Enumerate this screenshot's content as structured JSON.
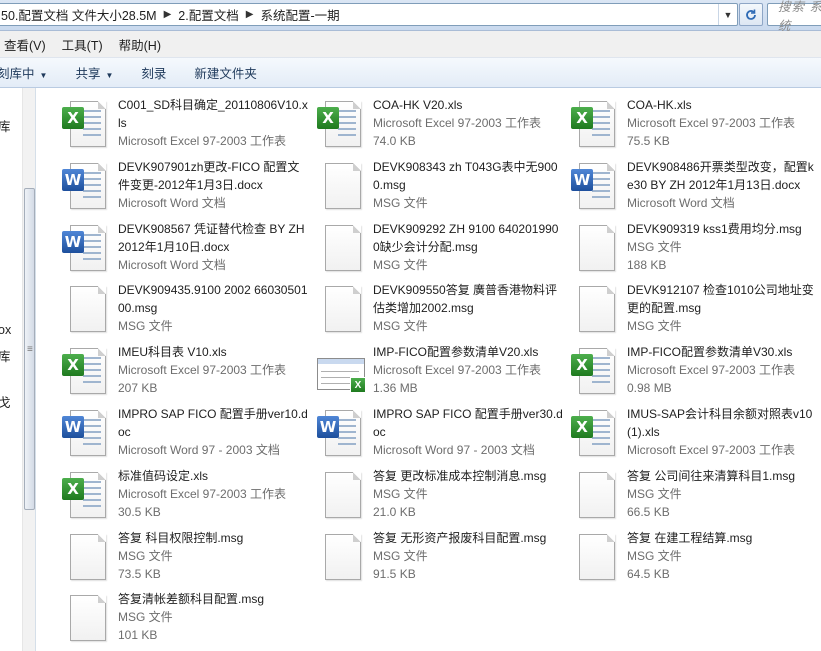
{
  "address": {
    "crumbs": [
      "50.配置文档 文件大小28.5M",
      "2.配置文档",
      "系统配置-一期"
    ],
    "search_placeholder": "搜索 系统"
  },
  "menu": [
    "查看(V)",
    "工具(T)",
    "帮助(H)"
  ],
  "commands": [
    "刻库中",
    "共享",
    "刻录",
    "新建文件夹"
  ],
  "nav": {
    "labels": [
      "库",
      "ox",
      "库",
      "戈"
    ]
  },
  "files": [
    {
      "name": "C001_SD科目确定_20110806V10.xls",
      "type": "Microsoft Excel 97-2003 工作表",
      "size": "",
      "icon": "excel"
    },
    {
      "name": "COA-HK V20.xls",
      "type": "Microsoft Excel 97-2003 工作表",
      "size": "74.0 KB",
      "icon": "excel"
    },
    {
      "name": "COA-HK.xls",
      "type": "Microsoft Excel 97-2003 工作表",
      "size": "75.5 KB",
      "icon": "excel"
    },
    {
      "name": "DEVK907901zh更改-FICO 配置文件变更-2012年1月3日.docx",
      "type": "Microsoft Word 文档",
      "size": "",
      "icon": "word"
    },
    {
      "name": "DEVK908343 zh T043G表中无9000.msg",
      "type": "MSG 文件",
      "size": "",
      "icon": "blank"
    },
    {
      "name": "DEVK908486开票类型改变，配置ke30 BY ZH 2012年1月13日.docx",
      "type": "Microsoft Word 文档",
      "size": "",
      "icon": "word"
    },
    {
      "name": "DEVK908567 凭证替代检查 BY ZH 2012年1月10日.docx",
      "type": "Microsoft Word 文档",
      "size": "",
      "icon": "word"
    },
    {
      "name": "DEVK909292  ZH 9100 6402019900缺少会计分配.msg",
      "type": "MSG 文件",
      "size": "",
      "icon": "blank"
    },
    {
      "name": "DEVK909319 kss1费用均分.msg",
      "type": "MSG 文件",
      "size": "188 KB",
      "icon": "blank"
    },
    {
      "name": "DEVK909435.9100  2002 6603050100.msg",
      "type": "MSG 文件",
      "size": "",
      "icon": "blank"
    },
    {
      "name": "DEVK909550答复 廣普香港物料评估类增加2002.msg",
      "type": "MSG 文件",
      "size": "",
      "icon": "blank"
    },
    {
      "name": "DEVK912107 检查1010公司地址变更的配置.msg",
      "type": "MSG 文件",
      "size": "",
      "icon": "blank"
    },
    {
      "name": "IMEU科目表 V10.xls",
      "type": "Microsoft Excel 97-2003 工作表",
      "size": "207 KB",
      "icon": "excel"
    },
    {
      "name": "IMP-FICO配置参数清单V20.xls",
      "type": "Microsoft Excel 97-2003 工作表",
      "size": "1.36 MB",
      "icon": "excel-preview"
    },
    {
      "name": "IMP-FICO配置参数清单V30.xls",
      "type": "Microsoft Excel 97-2003 工作表",
      "size": "0.98 MB",
      "icon": "excel"
    },
    {
      "name": "IMPRO SAP FICO 配置手册ver10.doc",
      "type": "Microsoft Word 97 - 2003 文档",
      "size": "",
      "icon": "word"
    },
    {
      "name": "IMPRO SAP FICO 配置手册ver30.doc",
      "type": "Microsoft Word 97 - 2003 文档",
      "size": "",
      "icon": "word"
    },
    {
      "name": "IMUS-SAP会计科目余额对照表v10(1).xls",
      "type": "Microsoft Excel 97-2003 工作表",
      "size": "",
      "icon": "excel"
    },
    {
      "name": "标准值码设定.xls",
      "type": "Microsoft Excel 97-2003 工作表",
      "size": "30.5 KB",
      "icon": "excel"
    },
    {
      "name": "答复 更改标准成本控制消息.msg",
      "type": "MSG 文件",
      "size": "21.0 KB",
      "icon": "blank"
    },
    {
      "name": "答复 公司间往来清算科目1.msg",
      "type": "MSG 文件",
      "size": "66.5 KB",
      "icon": "blank"
    },
    {
      "name": "答复 科目权限控制.msg",
      "type": "MSG 文件",
      "size": "73.5 KB",
      "icon": "blank"
    },
    {
      "name": "答复 无形资产报废科目配置.msg",
      "type": "MSG 文件",
      "size": "91.5 KB",
      "icon": "blank"
    },
    {
      "name": "答复 在建工程结算.msg",
      "type": "MSG 文件",
      "size": "64.5 KB",
      "icon": "blank"
    },
    {
      "name": "答复清帐差额科目配置.msg",
      "type": "MSG 文件",
      "size": "101 KB",
      "icon": "blank"
    }
  ]
}
